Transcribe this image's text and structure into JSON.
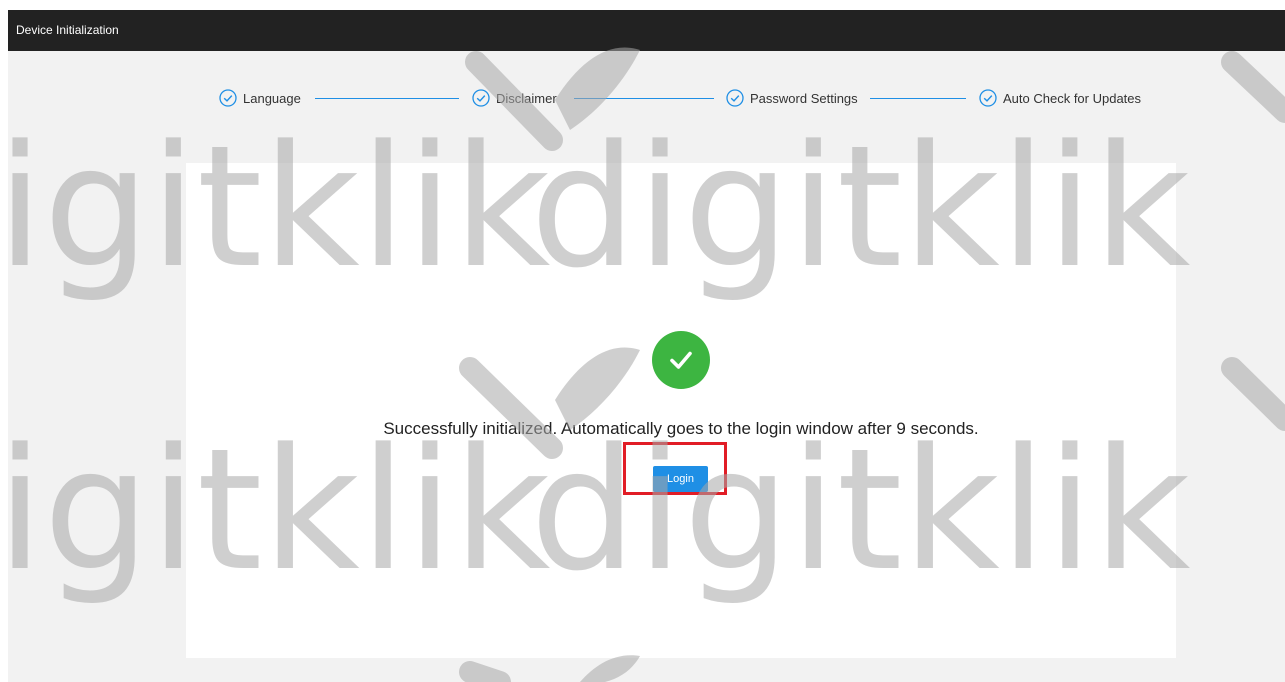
{
  "window": {
    "title": "Device Initialization"
  },
  "steps": [
    {
      "label": "Language",
      "status": "completed"
    },
    {
      "label": "Disclaimer",
      "status": "completed"
    },
    {
      "label": "Password Settings",
      "status": "completed"
    },
    {
      "label": "Auto Check for Updates",
      "status": "completed"
    }
  ],
  "result": {
    "icon": "checkmark-circle-icon",
    "message": "Successfully initialized. Automatically goes to the login window after 9 seconds.",
    "countdown_seconds": 9,
    "login_label": "Login"
  },
  "watermark": {
    "text": "digitklik"
  },
  "colors": {
    "titlebar": "#222222",
    "accent": "#1f8fe5",
    "success": "#3db541",
    "highlight": "#e11d26",
    "watermark": "#bdbdbd"
  }
}
